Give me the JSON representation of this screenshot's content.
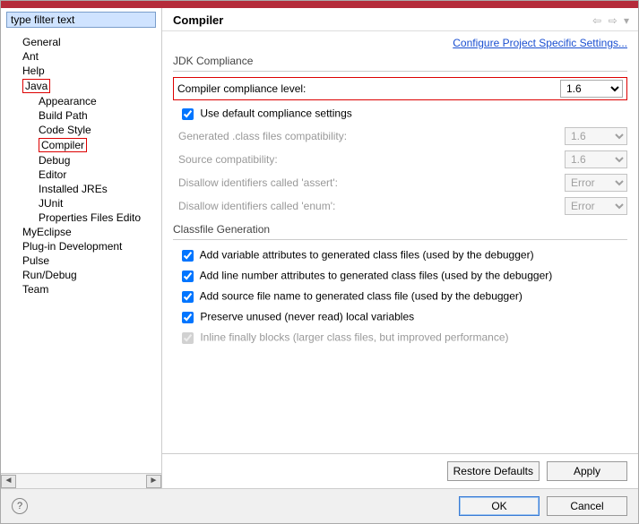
{
  "filter": {
    "placeholder": "type filter text",
    "value": "type filter text"
  },
  "tree": {
    "general": "General",
    "ant": "Ant",
    "help": "Help",
    "java": "Java",
    "appearance": "Appearance",
    "buildpath": "Build Path",
    "codestyle": "Code Style",
    "compiler": "Compiler",
    "debug": "Debug",
    "editor": "Editor",
    "installedjres": "Installed JREs",
    "junit": "JUnit",
    "propfiles": "Properties Files Edito",
    "myeclipse": "MyEclipse",
    "plugindev": "Plug-in Development",
    "pulse": "Pulse",
    "rundebug": "Run/Debug",
    "team": "Team"
  },
  "header": {
    "title": "Compiler"
  },
  "toplink": "Configure Project Specific Settings...",
  "jdk": {
    "group": "JDK Compliance",
    "compliance_label": "Compiler compliance level:",
    "compliance_value": "1.6",
    "use_default": "Use default compliance settings",
    "gen_class": "Generated .class files compatibility:",
    "gen_class_value": "1.6",
    "src_compat": "Source compatibility:",
    "src_compat_value": "1.6",
    "disallow_assert": "Disallow identifiers called 'assert':",
    "disallow_assert_value": "Error",
    "disallow_enum": "Disallow identifiers called 'enum':",
    "disallow_enum_value": "Error"
  },
  "classfile": {
    "group": "Classfile Generation",
    "var_attr": "Add variable attributes to generated class files (used by the debugger)",
    "line_attr": "Add line number attributes to generated class files (used by the debugger)",
    "src_file": "Add source file name to generated class file (used by the debugger)",
    "preserve": "Preserve unused (never read) local variables",
    "inline": "Inline finally blocks (larger class files, but improved performance)"
  },
  "buttons": {
    "restore": "Restore Defaults",
    "apply": "Apply",
    "ok": "OK",
    "cancel": "Cancel"
  }
}
